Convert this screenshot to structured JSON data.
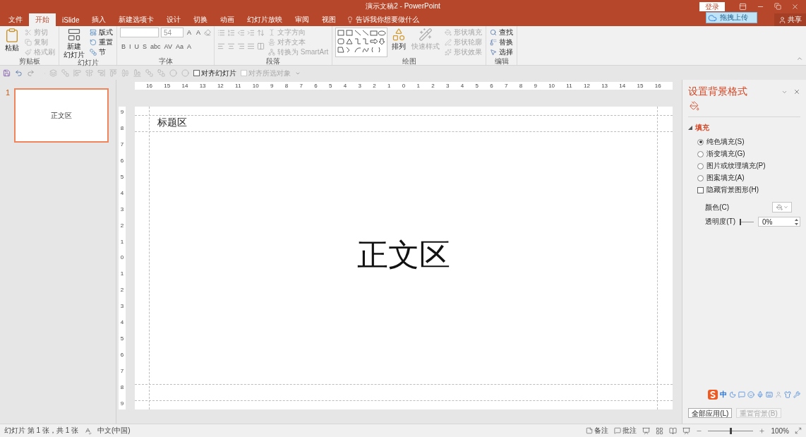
{
  "title_bar": {
    "title": "演示文稿2  -  PowerPoint",
    "login": "登录",
    "upload": "拖拽上传",
    "share": "共享"
  },
  "tabs": [
    {
      "label": "文件",
      "selected": false
    },
    {
      "label": "开始",
      "selected": true
    },
    {
      "label": "iSlide",
      "selected": false
    },
    {
      "label": "插入",
      "selected": false
    },
    {
      "label": "新建选项卡",
      "selected": false
    },
    {
      "label": "设计",
      "selected": false
    },
    {
      "label": "切换",
      "selected": false
    },
    {
      "label": "动画",
      "selected": false
    },
    {
      "label": "幻灯片放映",
      "selected": false
    },
    {
      "label": "审阅",
      "selected": false
    },
    {
      "label": "视图",
      "selected": false
    }
  ],
  "tell_me": "告诉我你想要做什么",
  "clipboard": {
    "label": "剪贴板",
    "paste": "粘贴",
    "items": [
      {
        "label": "剪切",
        "disabled": true
      },
      {
        "label": "复制",
        "disabled": true
      },
      {
        "label": "格式刷",
        "disabled": true
      }
    ]
  },
  "slides_group": {
    "label": "幻灯片",
    "new_slide": "新建",
    "new_slide_2": "幻灯片",
    "items": [
      {
        "label": "版式"
      },
      {
        "label": "重置"
      },
      {
        "label": "节"
      }
    ]
  },
  "font": {
    "label": "字体",
    "font_size": "54",
    "size_buttons": [
      "A",
      "A"
    ],
    "formats": [
      "B",
      "I",
      "U",
      "S",
      "abc",
      "AV",
      "Aa",
      "A"
    ]
  },
  "paragraph": {
    "label": "段落",
    "items": [
      {
        "label": "文字方向",
        "disabled": true
      },
      {
        "label": "对齐文本",
        "disabled": true
      },
      {
        "label": "转换为 SmartArt",
        "disabled": true
      }
    ]
  },
  "drawing": {
    "label": "绘图",
    "arrange": "排列",
    "quick_styles": {
      "label": "快速样式",
      "disabled": true
    },
    "items": [
      {
        "label": "形状填充",
        "disabled": true
      },
      {
        "label": "形状轮廓",
        "disabled": true
      },
      {
        "label": "形状效果",
        "disabled": true
      }
    ]
  },
  "editing": {
    "label": "编辑",
    "items": [
      "查找",
      "替换",
      "选择"
    ]
  },
  "qat": {
    "checkboxes": [
      {
        "label": "对齐幻灯片",
        "checked": false,
        "disabled": false
      },
      {
        "label": "对齐所选对象",
        "checked": false,
        "disabled": true
      }
    ]
  },
  "thumbnails": [
    {
      "number": "1",
      "selected": true,
      "body": "正文区"
    }
  ],
  "ruler": {
    "horizontal": [
      "16",
      "15",
      "14",
      "13",
      "12",
      "11",
      "10",
      "9",
      "8",
      "7",
      "6",
      "5",
      "4",
      "3",
      "2",
      "1",
      "0",
      "1",
      "2",
      "3",
      "4",
      "5",
      "6",
      "7",
      "8",
      "9",
      "10",
      "11",
      "12",
      "13",
      "14",
      "15",
      "16"
    ],
    "vertical": [
      "9",
      "8",
      "7",
      "6",
      "5",
      "4",
      "3",
      "2",
      "1",
      "0",
      "1",
      "2",
      "3",
      "4",
      "5",
      "6",
      "7",
      "8",
      "9"
    ]
  },
  "slide": {
    "title": "标题区",
    "body": "正文区"
  },
  "format_pane": {
    "title": "设置背景格式",
    "section": "填充",
    "expanded": true,
    "options": [
      {
        "label": "纯色填充(S)",
        "selected": true
      },
      {
        "label": "渐变填充(G)",
        "selected": false
      },
      {
        "label": "图片或纹理填充(P)",
        "selected": false
      },
      {
        "label": "图案填充(A)",
        "selected": false
      }
    ],
    "hide_graphics": {
      "label": "隐藏背景图形(H)",
      "checked": false
    },
    "color_label": "颜色(C)",
    "transparency_label": "透明度(T)",
    "transparency": {
      "level": 0
    },
    "transparency_value": "0%",
    "buttons": [
      {
        "label": "全部应用(L)",
        "disabled": false
      },
      {
        "label": "重置背景(B)",
        "disabled": true
      }
    ]
  },
  "ime": {
    "mode": "中"
  },
  "status_bar": {
    "slide_info": "幻灯片 第 1 张，共 1 张",
    "language": "中文(中国)",
    "notes": "备注",
    "comments": "批注",
    "zoom": {
      "level": 0.5
    },
    "zoom_value": "100%"
  }
}
